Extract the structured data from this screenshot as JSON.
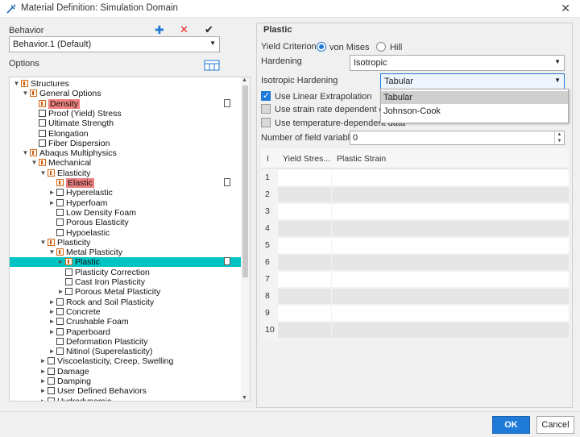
{
  "window": {
    "title": "Material Definition: Simulation Domain",
    "close_glyph": "✕"
  },
  "left": {
    "behavior_label": "Behavior",
    "behavior_value": "Behavior.1 (Default)",
    "options_label": "Options",
    "add_glyph": "✚",
    "delete_glyph": "✕",
    "apply_glyph": "✔",
    "tree": [
      {
        "text": "Structures",
        "level": 0,
        "toggle": "▼",
        "box": "p"
      },
      {
        "text": "General Options",
        "level": 1,
        "toggle": "▼",
        "box": "p"
      },
      {
        "text": "Density",
        "level": 2,
        "toggle": "",
        "box": "p",
        "highlight": true,
        "edit": true
      },
      {
        "text": "Proof (Yield) Stress",
        "level": 2,
        "toggle": "",
        "box": "e"
      },
      {
        "text": "Ultimate Strength",
        "level": 2,
        "toggle": "",
        "box": "e"
      },
      {
        "text": "Elongation",
        "level": 2,
        "toggle": "",
        "box": "e"
      },
      {
        "text": "Fiber Dispersion",
        "level": 2,
        "toggle": "",
        "box": "e"
      },
      {
        "text": "Abaqus Multiphysics",
        "level": 1,
        "toggle": "▼",
        "box": "p"
      },
      {
        "text": "Mechanical",
        "level": 2,
        "toggle": "▼",
        "box": "p"
      },
      {
        "text": "Elasticity",
        "level": 3,
        "toggle": "▼",
        "box": "p"
      },
      {
        "text": "Elastic",
        "level": 4,
        "toggle": "",
        "box": "p",
        "highlight": true,
        "edit": true
      },
      {
        "text": "Hyperelastic",
        "level": 4,
        "toggle": "►",
        "box": "e"
      },
      {
        "text": "Hyperfoam",
        "level": 4,
        "toggle": "►",
        "box": "e"
      },
      {
        "text": "Low Density Foam",
        "level": 4,
        "toggle": "",
        "box": "e"
      },
      {
        "text": "Porous Elasticity",
        "level": 4,
        "toggle": "",
        "box": "e"
      },
      {
        "text": "Hypoelastic",
        "level": 4,
        "toggle": "",
        "box": "e"
      },
      {
        "text": "Plasticity",
        "level": 3,
        "toggle": "▼",
        "box": "p"
      },
      {
        "text": "Metal Plasticity",
        "level": 4,
        "toggle": "▼",
        "box": "p"
      },
      {
        "text": "Plastic",
        "level": 5,
        "toggle": "►",
        "box": "p",
        "selected": true,
        "edit": true
      },
      {
        "text": "Plasticity Correction",
        "level": 5,
        "toggle": "",
        "box": "e"
      },
      {
        "text": "Cast Iron Plasticity",
        "level": 5,
        "toggle": "",
        "box": "e"
      },
      {
        "text": "Porous Metal Plasticity",
        "level": 5,
        "toggle": "►",
        "box": "e"
      },
      {
        "text": "Rock and Soil Plasticity",
        "level": 4,
        "toggle": "►",
        "box": "e"
      },
      {
        "text": "Concrete",
        "level": 4,
        "toggle": "►",
        "box": "e"
      },
      {
        "text": "Crushable Foam",
        "level": 4,
        "toggle": "►",
        "box": "e"
      },
      {
        "text": "Paperboard",
        "level": 4,
        "toggle": "►",
        "box": "e"
      },
      {
        "text": "Deformation Plasticity",
        "level": 4,
        "toggle": "",
        "box": "e"
      },
      {
        "text": "Nitinol (Superelasticity)",
        "level": 4,
        "toggle": "►",
        "box": "e"
      },
      {
        "text": "Viscoelasticity, Creep, Swelling",
        "level": 3,
        "toggle": "►",
        "box": "e"
      },
      {
        "text": "Damage",
        "level": 3,
        "toggle": "►",
        "box": "e"
      },
      {
        "text": "Damping",
        "level": 3,
        "toggle": "►",
        "box": "e"
      },
      {
        "text": "User Defined Behaviors",
        "level": 3,
        "toggle": "►",
        "box": "e"
      },
      {
        "text": "Hydrodynamic",
        "level": 3,
        "toggle": "►",
        "box": "e"
      }
    ]
  },
  "right": {
    "section_title": "Plastic",
    "yield_label": "Yield Criterion",
    "yield_options": [
      "von Mises",
      "Hill"
    ],
    "hardening_label": "Hardening",
    "hardening_value": "Isotropic",
    "iso_label": "Isotropic Hardening",
    "iso_value": "Tabular",
    "iso_options": [
      "Tabular",
      "Johnson-Cook"
    ],
    "check_linear": "Use Linear Extrapolation",
    "check_strain": "Use strain rate dependent data",
    "check_temp": "Use temperature-dependent data",
    "field_label": "Number of field variables",
    "field_value": "0",
    "table_headers": [
      "I",
      "Yield Stres...",
      "Plastic Strain"
    ],
    "row_numbers": [
      "1",
      "2",
      "3",
      "4",
      "5",
      "6",
      "7",
      "8",
      "9",
      "10"
    ]
  },
  "footer": {
    "ok": "OK",
    "cancel": "Cancel"
  }
}
